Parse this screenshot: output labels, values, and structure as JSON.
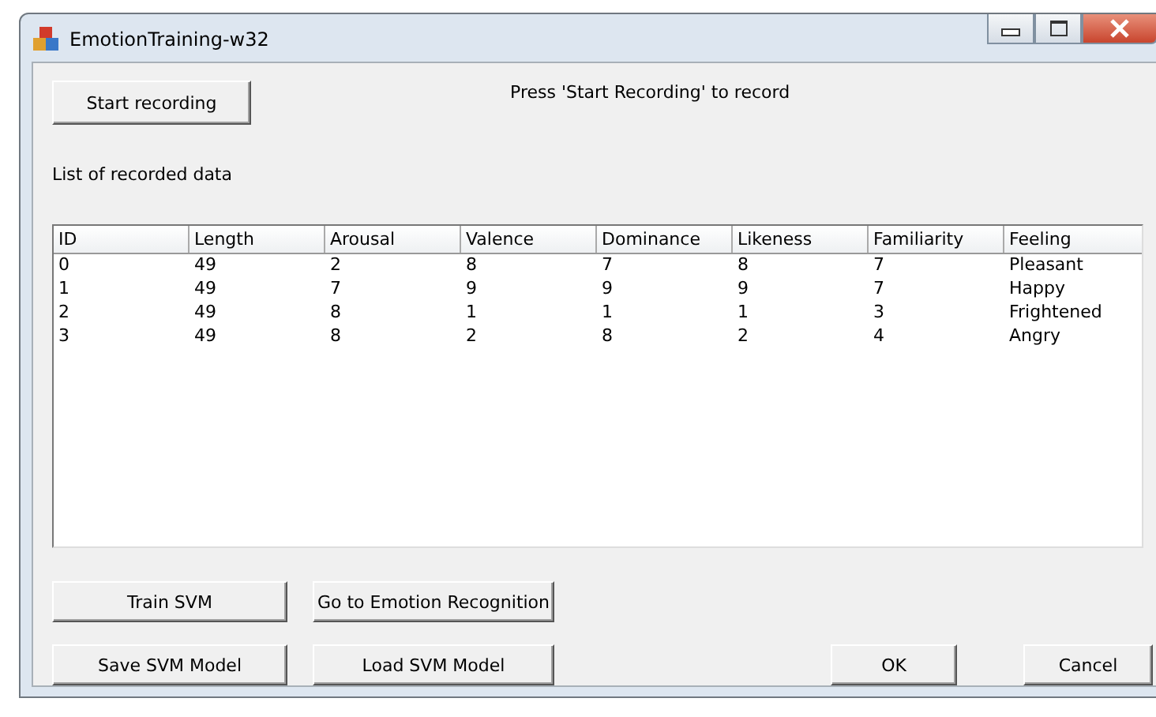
{
  "window": {
    "title": "EmotionTraining-w32"
  },
  "record_button": "Start recording",
  "status_text": "Press 'Start Recording' to record",
  "list_label": "List of recorded data",
  "table": {
    "columns": [
      "ID",
      "Length",
      "Arousal",
      "Valence",
      "Dominance",
      "Likeness",
      "Familiarity",
      "Feeling"
    ],
    "rows": [
      [
        "0",
        "49",
        "2",
        "8",
        "7",
        "8",
        "7",
        "Pleasant"
      ],
      [
        "1",
        "49",
        "7",
        "9",
        "9",
        "9",
        "7",
        "Happy"
      ],
      [
        "2",
        "49",
        "8",
        "1",
        "1",
        "1",
        "3",
        "Frightened"
      ],
      [
        "3",
        "49",
        "8",
        "2",
        "8",
        "2",
        "4",
        "Angry"
      ]
    ]
  },
  "svm_buttons": [
    [
      "Train SVM",
      "Go to Emotion Recognition"
    ],
    [
      "Save SVM Model",
      "Load SVM Model"
    ]
  ],
  "dialog_buttons": [
    "OK",
    "Cancel"
  ]
}
